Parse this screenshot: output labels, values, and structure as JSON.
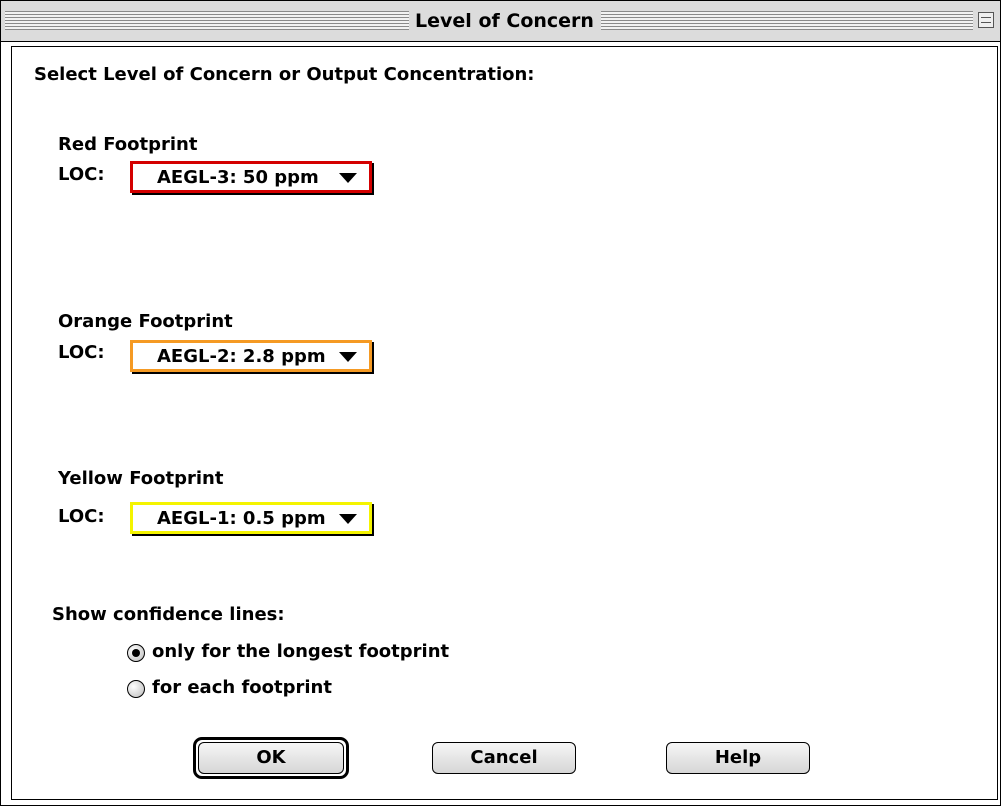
{
  "window": {
    "title": "Level of Concern"
  },
  "prompt": "Select Level of Concern or Output Concentration:",
  "footprints": [
    {
      "heading": "Red Footprint",
      "loc_label": "LOC:",
      "value": "AEGL-3: 50 ppm",
      "color": "#d40000"
    },
    {
      "heading": "Orange Footprint",
      "loc_label": "LOC:",
      "value": "AEGL-2: 2.8 ppm",
      "color": "#f59a23"
    },
    {
      "heading": "Yellow Footprint",
      "loc_label": "LOC:",
      "value": "AEGL-1: 0.5 ppm",
      "color": "#f4f400"
    }
  ],
  "confidence": {
    "heading": "Show confidence lines:",
    "options": [
      {
        "label": "only for the longest footprint",
        "selected": true
      },
      {
        "label": "for each footprint",
        "selected": false
      }
    ]
  },
  "buttons": {
    "ok": "OK",
    "cancel": "Cancel",
    "help": "Help"
  }
}
